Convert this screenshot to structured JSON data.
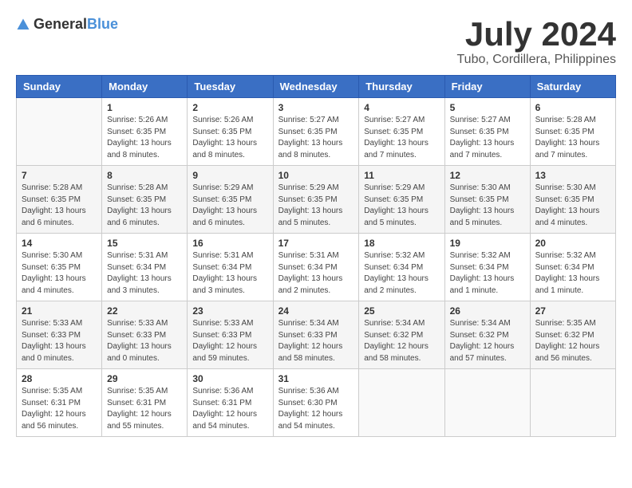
{
  "logo": {
    "general": "General",
    "blue": "Blue"
  },
  "title": "July 2024",
  "location": "Tubo, Cordillera, Philippines",
  "days_of_week": [
    "Sunday",
    "Monday",
    "Tuesday",
    "Wednesday",
    "Thursday",
    "Friday",
    "Saturday"
  ],
  "weeks": [
    [
      {
        "day": "",
        "info": ""
      },
      {
        "day": "1",
        "info": "Sunrise: 5:26 AM\nSunset: 6:35 PM\nDaylight: 13 hours and 8 minutes."
      },
      {
        "day": "2",
        "info": "Sunrise: 5:26 AM\nSunset: 6:35 PM\nDaylight: 13 hours and 8 minutes."
      },
      {
        "day": "3",
        "info": "Sunrise: 5:27 AM\nSunset: 6:35 PM\nDaylight: 13 hours and 8 minutes."
      },
      {
        "day": "4",
        "info": "Sunrise: 5:27 AM\nSunset: 6:35 PM\nDaylight: 13 hours and 7 minutes."
      },
      {
        "day": "5",
        "info": "Sunrise: 5:27 AM\nSunset: 6:35 PM\nDaylight: 13 hours and 7 minutes."
      },
      {
        "day": "6",
        "info": "Sunrise: 5:28 AM\nSunset: 6:35 PM\nDaylight: 13 hours and 7 minutes."
      }
    ],
    [
      {
        "day": "7",
        "info": "Sunrise: 5:28 AM\nSunset: 6:35 PM\nDaylight: 13 hours and 6 minutes."
      },
      {
        "day": "8",
        "info": "Sunrise: 5:28 AM\nSunset: 6:35 PM\nDaylight: 13 hours and 6 minutes."
      },
      {
        "day": "9",
        "info": "Sunrise: 5:29 AM\nSunset: 6:35 PM\nDaylight: 13 hours and 6 minutes."
      },
      {
        "day": "10",
        "info": "Sunrise: 5:29 AM\nSunset: 6:35 PM\nDaylight: 13 hours and 5 minutes."
      },
      {
        "day": "11",
        "info": "Sunrise: 5:29 AM\nSunset: 6:35 PM\nDaylight: 13 hours and 5 minutes."
      },
      {
        "day": "12",
        "info": "Sunrise: 5:30 AM\nSunset: 6:35 PM\nDaylight: 13 hours and 5 minutes."
      },
      {
        "day": "13",
        "info": "Sunrise: 5:30 AM\nSunset: 6:35 PM\nDaylight: 13 hours and 4 minutes."
      }
    ],
    [
      {
        "day": "14",
        "info": "Sunrise: 5:30 AM\nSunset: 6:35 PM\nDaylight: 13 hours and 4 minutes."
      },
      {
        "day": "15",
        "info": "Sunrise: 5:31 AM\nSunset: 6:34 PM\nDaylight: 13 hours and 3 minutes."
      },
      {
        "day": "16",
        "info": "Sunrise: 5:31 AM\nSunset: 6:34 PM\nDaylight: 13 hours and 3 minutes."
      },
      {
        "day": "17",
        "info": "Sunrise: 5:31 AM\nSunset: 6:34 PM\nDaylight: 13 hours and 2 minutes."
      },
      {
        "day": "18",
        "info": "Sunrise: 5:32 AM\nSunset: 6:34 PM\nDaylight: 13 hours and 2 minutes."
      },
      {
        "day": "19",
        "info": "Sunrise: 5:32 AM\nSunset: 6:34 PM\nDaylight: 13 hours and 1 minute."
      },
      {
        "day": "20",
        "info": "Sunrise: 5:32 AM\nSunset: 6:34 PM\nDaylight: 13 hours and 1 minute."
      }
    ],
    [
      {
        "day": "21",
        "info": "Sunrise: 5:33 AM\nSunset: 6:33 PM\nDaylight: 13 hours and 0 minutes."
      },
      {
        "day": "22",
        "info": "Sunrise: 5:33 AM\nSunset: 6:33 PM\nDaylight: 13 hours and 0 minutes."
      },
      {
        "day": "23",
        "info": "Sunrise: 5:33 AM\nSunset: 6:33 PM\nDaylight: 12 hours and 59 minutes."
      },
      {
        "day": "24",
        "info": "Sunrise: 5:34 AM\nSunset: 6:33 PM\nDaylight: 12 hours and 58 minutes."
      },
      {
        "day": "25",
        "info": "Sunrise: 5:34 AM\nSunset: 6:32 PM\nDaylight: 12 hours and 58 minutes."
      },
      {
        "day": "26",
        "info": "Sunrise: 5:34 AM\nSunset: 6:32 PM\nDaylight: 12 hours and 57 minutes."
      },
      {
        "day": "27",
        "info": "Sunrise: 5:35 AM\nSunset: 6:32 PM\nDaylight: 12 hours and 56 minutes."
      }
    ],
    [
      {
        "day": "28",
        "info": "Sunrise: 5:35 AM\nSunset: 6:31 PM\nDaylight: 12 hours and 56 minutes."
      },
      {
        "day": "29",
        "info": "Sunrise: 5:35 AM\nSunset: 6:31 PM\nDaylight: 12 hours and 55 minutes."
      },
      {
        "day": "30",
        "info": "Sunrise: 5:36 AM\nSunset: 6:31 PM\nDaylight: 12 hours and 54 minutes."
      },
      {
        "day": "31",
        "info": "Sunrise: 5:36 AM\nSunset: 6:30 PM\nDaylight: 12 hours and 54 minutes."
      },
      {
        "day": "",
        "info": ""
      },
      {
        "day": "",
        "info": ""
      },
      {
        "day": "",
        "info": ""
      }
    ]
  ]
}
